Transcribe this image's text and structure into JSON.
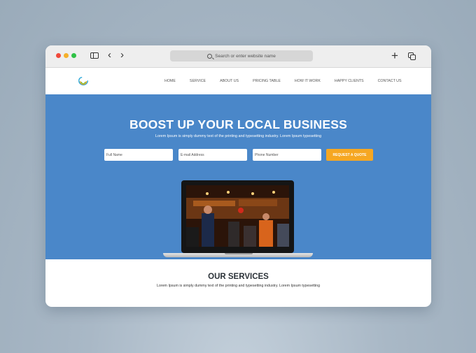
{
  "browser": {
    "address_placeholder": "Search or enter website name"
  },
  "nav": {
    "items": [
      "HOME",
      "SERVICE",
      "ABOUT US",
      "PRICING TABLE",
      "HOW IT WORK",
      "HAPPY CLIENTS",
      "CONTACT US"
    ]
  },
  "hero": {
    "title": "BOOST UP YOUR LOCAL BUSINESS",
    "subtitle": "Lorem Ipsum is simply dummy text of the printing and typesetting industry. Lorem Ipsum typesetting",
    "form": {
      "full_name": "Full Name",
      "email": "E-mail Address",
      "phone": "Phone Number",
      "button": "REQUEST A QUOTE"
    }
  },
  "services": {
    "title": "OUR SERVICES",
    "subtitle": "Lorem Ipsum is simply dummy text of the printing and typesetting industry. Lorem Ipsum typesetting"
  },
  "colors": {
    "hero_bg": "#4a87c9",
    "accent": "#f6a722"
  }
}
